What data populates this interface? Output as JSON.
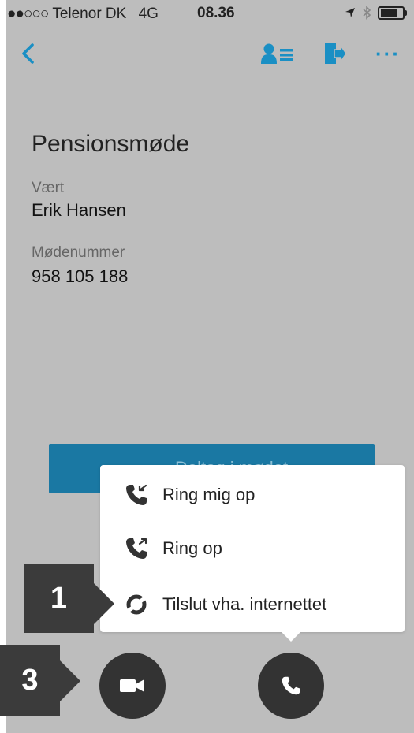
{
  "status_bar": {
    "signal_dots": "●●○○○",
    "carrier": "Telenor DK",
    "network": "4G",
    "time": "08.36"
  },
  "nav": {
    "back_icon": "chevron-left-icon",
    "participants_icon": "participants-list-icon",
    "leave_icon": "exit-door-icon",
    "more_label": "···"
  },
  "meeting": {
    "title": "Pensionsmøde",
    "host_label": "Vært",
    "host_name": "Erik Hansen",
    "number_label": "Mødenummer",
    "number": "958 105 188"
  },
  "join_button": {
    "label": "Deltag i mødet"
  },
  "audio_menu": {
    "items": [
      {
        "label": "Ring mig op",
        "icon": "phone-incoming-icon"
      },
      {
        "label": "Ring op",
        "icon": "phone-outgoing-icon"
      },
      {
        "label": "Tilslut vha. internettet",
        "icon": "internet-audio-icon"
      }
    ]
  },
  "bottom_bar": {
    "video_icon": "video-camera-icon",
    "phone_icon": "phone-icon"
  },
  "callouts": {
    "one": "1",
    "three": "3"
  },
  "colors": {
    "accent": "#1a8fc4",
    "background": "#bdbdbd",
    "button_dark": "#333333",
    "join_button": "#1a78a3",
    "callout": "#3b3b3b"
  }
}
